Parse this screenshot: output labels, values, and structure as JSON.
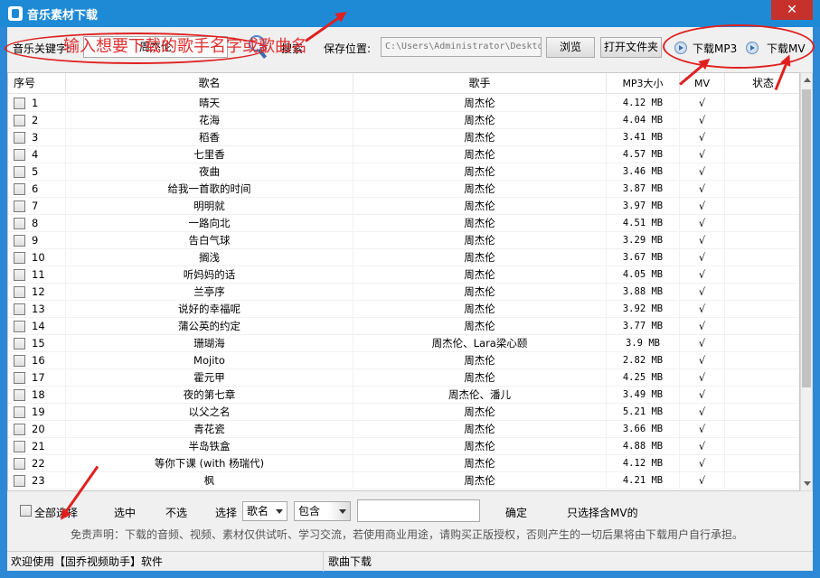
{
  "window": {
    "title": "音乐素材下载",
    "close_glyph": "✕"
  },
  "toolbar": {
    "keyword_label": "音乐关键字:",
    "keyword_value": "周杰伦",
    "search_label": "搜索",
    "save_label": "保存位置:",
    "save_path": "C:\\Users\\Administrator\\Deskto",
    "browse_label": "浏览",
    "open_folder_label": "打开文件夹",
    "download_mp3_label": "下载MP3",
    "download_mv_label": "下载MV"
  },
  "hint": "输入想要下载的歌手名字或歌曲名",
  "table": {
    "headers": {
      "idx": "序号",
      "name": "歌名",
      "singer": "歌手",
      "size": "MP3大小",
      "mv": "MV",
      "status": "状态"
    },
    "rows": [
      {
        "idx": "1",
        "name": "晴天",
        "singer": "周杰伦",
        "size": "4.12 MB",
        "mv": "√"
      },
      {
        "idx": "2",
        "name": "花海",
        "singer": "周杰伦",
        "size": "4.04 MB",
        "mv": "√"
      },
      {
        "idx": "3",
        "name": "稻香",
        "singer": "周杰伦",
        "size": "3.41 MB",
        "mv": "√"
      },
      {
        "idx": "4",
        "name": "七里香",
        "singer": "周杰伦",
        "size": "4.57 MB",
        "mv": "√"
      },
      {
        "idx": "5",
        "name": "夜曲",
        "singer": "周杰伦",
        "size": "3.46 MB",
        "mv": "√"
      },
      {
        "idx": "6",
        "name": "给我一首歌的时间",
        "singer": "周杰伦",
        "size": "3.87 MB",
        "mv": "√"
      },
      {
        "idx": "7",
        "name": "明明就",
        "singer": "周杰伦",
        "size": "3.97 MB",
        "mv": "√"
      },
      {
        "idx": "8",
        "name": "一路向北",
        "singer": "周杰伦",
        "size": "4.51 MB",
        "mv": "√"
      },
      {
        "idx": "9",
        "name": "告白气球",
        "singer": "周杰伦",
        "size": "3.29 MB",
        "mv": "√"
      },
      {
        "idx": "10",
        "name": "搁浅",
        "singer": "周杰伦",
        "size": "3.67 MB",
        "mv": "√"
      },
      {
        "idx": "11",
        "name": "听妈妈的话",
        "singer": "周杰伦",
        "size": "4.05 MB",
        "mv": "√"
      },
      {
        "idx": "12",
        "name": "兰亭序",
        "singer": "周杰伦",
        "size": "3.88 MB",
        "mv": "√"
      },
      {
        "idx": "13",
        "name": "说好的幸福呢",
        "singer": "周杰伦",
        "size": "3.92 MB",
        "mv": "√"
      },
      {
        "idx": "14",
        "name": "蒲公英的约定",
        "singer": "周杰伦",
        "size": "3.77 MB",
        "mv": "√"
      },
      {
        "idx": "15",
        "name": "珊瑚海",
        "singer": "周杰伦、Lara梁心颐",
        "size": "3.9 MB",
        "mv": "√"
      },
      {
        "idx": "16",
        "name": "Mojito",
        "singer": "周杰伦",
        "size": "2.82 MB",
        "mv": "√"
      },
      {
        "idx": "17",
        "name": "霍元甲",
        "singer": "周杰伦",
        "size": "4.25 MB",
        "mv": "√"
      },
      {
        "idx": "18",
        "name": "夜的第七章",
        "singer": "周杰伦、潘儿",
        "size": "3.49 MB",
        "mv": "√"
      },
      {
        "idx": "19",
        "name": "以父之名",
        "singer": "周杰伦",
        "size": "5.21 MB",
        "mv": "√"
      },
      {
        "idx": "20",
        "name": "青花瓷",
        "singer": "周杰伦",
        "size": "3.66 MB",
        "mv": "√"
      },
      {
        "idx": "21",
        "name": "半岛铁盒",
        "singer": "周杰伦",
        "size": "4.88 MB",
        "mv": "√"
      },
      {
        "idx": "22",
        "name": "等你下课 (with 杨瑞代)",
        "singer": "周杰伦",
        "size": "4.12 MB",
        "mv": "√"
      },
      {
        "idx": "23",
        "name": "枫",
        "singer": "周杰伦",
        "size": "4.21 MB",
        "mv": "√"
      }
    ]
  },
  "bottom": {
    "select_all_label": "全部选择",
    "select_label": "选中",
    "deselect_label": "不选",
    "choose_label": "选择",
    "field_option": "歌名",
    "match_option": "包含",
    "filter_value": "",
    "confirm_label": "确定",
    "mv_only_label": "只选择含MV的",
    "disclaimer": "免责声明：下载的音频、视频、素材仅供试听、学习交流，若使用商业用途，请购买正版授权，否则产生的一切后果将由下载用户自行承担。"
  },
  "statusbar": {
    "left": "欢迎使用【固乔视频助手】软件",
    "right": "歌曲下载"
  },
  "colors": {
    "titlebar": "#1e8ad6",
    "annotation": "#e02020",
    "close": "#c7312c"
  }
}
